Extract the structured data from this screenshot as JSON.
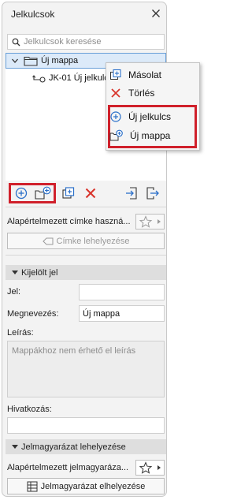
{
  "panel": {
    "title": "Jelkulcsok"
  },
  "search": {
    "placeholder": "Jelkulcsok keresése"
  },
  "tree": {
    "folder_label": "Új mappa",
    "item_label": "JK-01 Új jelkulcs"
  },
  "context_menu": {
    "items": [
      "Másolat",
      "Törlés",
      "Új jelkulcs",
      "Új mappa"
    ]
  },
  "controls": {
    "default_label_field": "Alapértelmezett címke haszná...",
    "place_label_button": "Címke lehelyezése"
  },
  "selected_section": {
    "title": "Kijelölt jel",
    "jel_label": "Jel:",
    "jel_value": "",
    "name_label": "Megnevezés:",
    "name_value": "Új mappa",
    "desc_label": "Leírás:",
    "desc_placeholder": "Mappákhoz nem érhető el leírás",
    "ref_label": "Hivatkozás:",
    "ref_value": ""
  },
  "legend_section": {
    "title": "Jelmagyarázat lehelyezése",
    "default_legend_field": "Alapértelmezett jelmagyaráza...",
    "place_legend_button": "Jelmagyarázat elhelyezése"
  },
  "colors": {
    "highlight_red": "#d0202b",
    "accent_blue": "#2a6fc9",
    "selection": "#dceaf9"
  }
}
